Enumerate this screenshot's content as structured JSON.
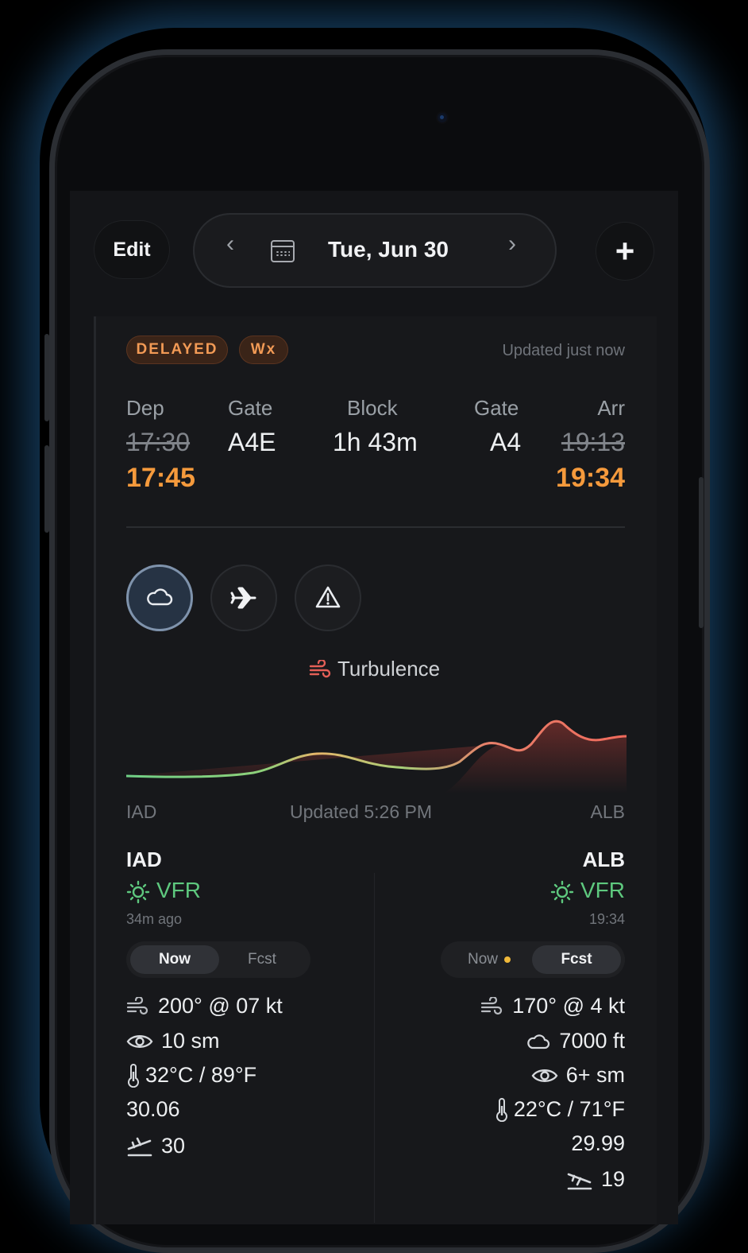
{
  "toolbar": {
    "edit_label": "Edit",
    "date": "Tue, Jun 30",
    "prev_symbol": "‹",
    "next_symbol": "›",
    "add_symbol": "+"
  },
  "card": {
    "badges": [
      "DELAYED",
      "Wx"
    ],
    "updated": "Updated just now",
    "columns": {
      "dep": {
        "label": "Dep",
        "scheduled": "17:30",
        "actual": "17:45"
      },
      "gate_dep": {
        "label": "Gate",
        "value": "A4E"
      },
      "block": {
        "label": "Block",
        "value": "1h 43m"
      },
      "gate_arr": {
        "label": "Gate",
        "value": "A4"
      },
      "arr": {
        "label": "Arr",
        "scheduled": "19:13",
        "actual": "19:34"
      }
    },
    "tabs": [
      {
        "icon": "cloud-icon",
        "active": true
      },
      {
        "icon": "airplane-icon",
        "active": false
      },
      {
        "icon": "warning-icon",
        "active": false
      }
    ],
    "section_title": "Turbulence",
    "route": {
      "from": "IAD",
      "to": "ALB",
      "updated": "Updated 5:26 PM"
    },
    "colors": {
      "accent_orange": "#f59a3c",
      "vfr_green": "#5ec87e",
      "turb_low": "#6fcf86",
      "turb_high": "#f06a5c"
    }
  },
  "departure": {
    "code": "IAD",
    "category": "VFR",
    "age": "34m ago",
    "seg": {
      "now": "Now",
      "fcst": "Fcst",
      "selected": "Now"
    },
    "wind": "200° @ 07 kt",
    "visibility": "10 sm",
    "temp": "32°C / 89°F",
    "altimeter": "30.06",
    "runway": "30"
  },
  "arrival": {
    "code": "ALB",
    "category": "VFR",
    "time": "19:34",
    "seg": {
      "now": "Now",
      "fcst": "Fcst",
      "selected": "Fcst"
    },
    "wind": "170° @ 4 kt",
    "ceiling": "7000 ft",
    "visibility": "6+ sm",
    "temp": "22°C / 71°F",
    "altimeter": "29.99",
    "runway": "19"
  }
}
